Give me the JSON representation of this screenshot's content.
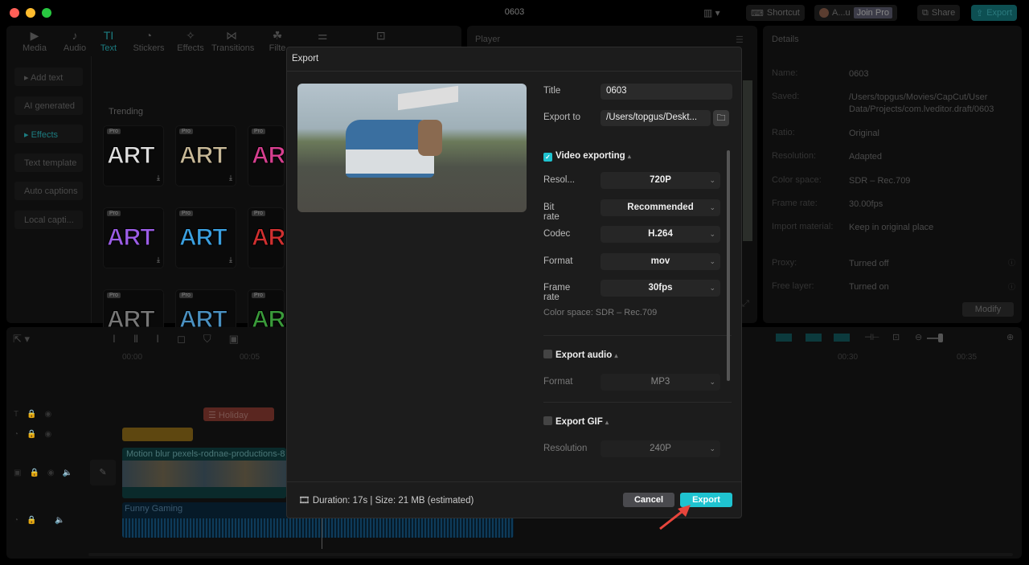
{
  "window": {
    "title": "0603"
  },
  "topbar": {
    "shortcut": "Shortcut",
    "user": "A...u",
    "join_pro": "Join Pro",
    "share": "Share",
    "export": "Export"
  },
  "nav_tabs": [
    {
      "label": "Media",
      "icon": "▶"
    },
    {
      "label": "Audio",
      "icon": "♪"
    },
    {
      "label": "Text",
      "icon": "TI"
    },
    {
      "label": "Stickers",
      "icon": "◔"
    },
    {
      "label": "Effects",
      "icon": "✧"
    },
    {
      "label": "Transitions",
      "icon": "⋈"
    },
    {
      "label": "Filte",
      "icon": "☘"
    }
  ],
  "side_items": [
    "▸ Add text",
    "AI generated",
    "▸ Effects",
    "Text template",
    "Auto captions",
    "Local capti..."
  ],
  "trending": "Trending",
  "pro_badge": "Pro",
  "art": "ART",
  "player": {
    "title": "Player"
  },
  "details": {
    "title": "Details",
    "rows": [
      [
        "Name:",
        "0603"
      ],
      [
        "Saved:",
        "/Users/topgus/Movies/CapCut/User Data/Projects/com.lveditor.draft/0603"
      ],
      [
        "Ratio:",
        "Original"
      ],
      [
        "Resolution:",
        "Adapted"
      ],
      [
        "Color space:",
        "SDR – Rec.709"
      ],
      [
        "Frame rate:",
        "30.00fps"
      ],
      [
        "Import material:",
        "Keep in original place"
      ],
      [
        "Proxy:",
        "Turned off"
      ],
      [
        "Free layer:",
        "Turned on"
      ]
    ],
    "modify": "Modify"
  },
  "timeline": {
    "ticks": [
      "00:00",
      "00:05",
      "00:30",
      "00:35"
    ],
    "clips": {
      "text": "Holiday",
      "video": "Motion blur  pexels-rodnae-productions-8",
      "audio": "Funny Gaming"
    }
  },
  "dialog": {
    "title": "Export",
    "title_label": "Title",
    "title_value": "0603",
    "export_to_label": "Export to",
    "export_to_value": "/Users/topgus/Deskt...",
    "video": {
      "label": "Video exporting",
      "checked": true,
      "rows": [
        [
          "Resol...",
          "720P"
        ],
        [
          "Bit rate",
          "Recommended"
        ],
        [
          "Codec",
          "H.264"
        ],
        [
          "Format",
          "mov"
        ],
        [
          "Frame rate",
          "30fps"
        ]
      ],
      "color_space": "Color space: SDR – Rec.709"
    },
    "audio": {
      "label": "Export audio",
      "checked": false,
      "format_label": "Format",
      "format_value": "MP3"
    },
    "gif": {
      "label": "Export GIF",
      "checked": false,
      "res_label": "Resolution",
      "res_value": "240P"
    },
    "footer": "Duration: 17s | Size: 21 MB (estimated)",
    "cancel": "Cancel",
    "export": "Export"
  },
  "colors": {
    "accent": "#1fc3d0",
    "active_tab": "#1c7c80"
  }
}
